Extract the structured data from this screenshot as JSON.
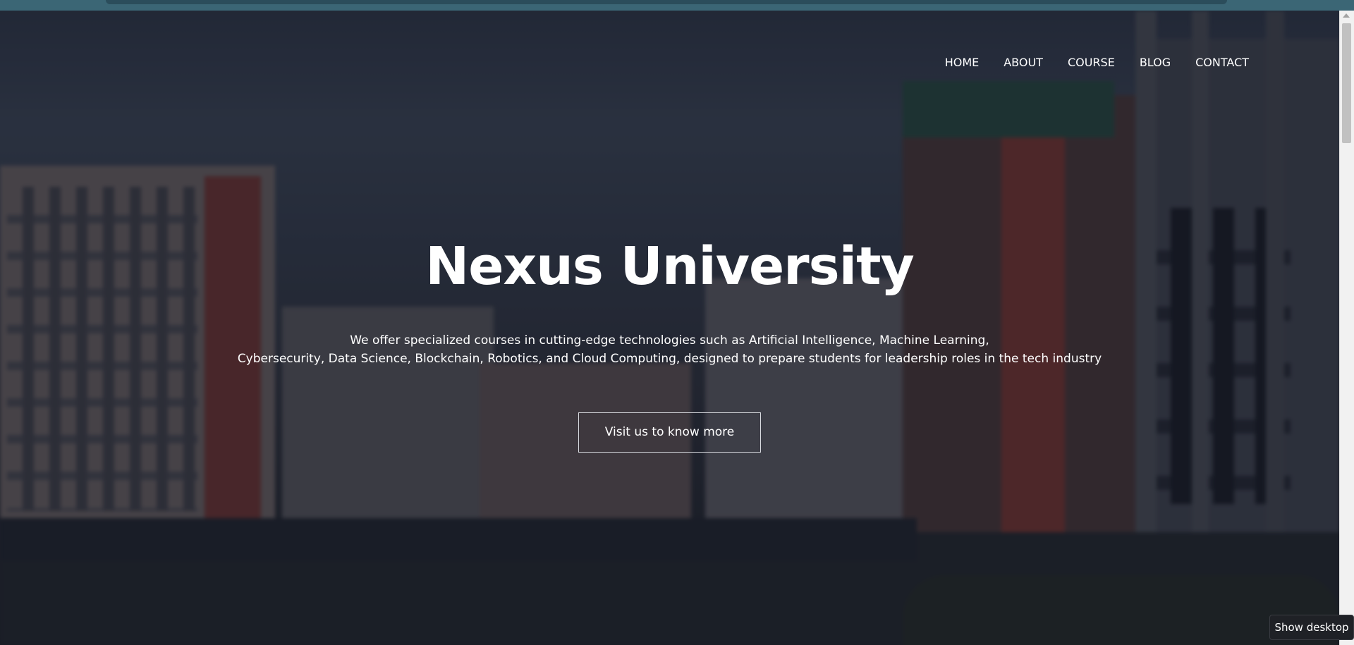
{
  "nav": {
    "items": [
      "HOME",
      "ABOUT",
      "COURSE",
      "BLOG",
      "CONTACT"
    ]
  },
  "hero": {
    "title": "Nexus University",
    "description_line1": "We offer specialized courses in cutting-edge technologies such as Artificial Intelligence, Machine Learning,",
    "description_line2": "Cybersecurity, Data Science, Blockchain, Robotics, and Cloud Computing, designed to prepare students for leadership roles in the tech industry",
    "cta_label": "Visit us to know more"
  },
  "taskbar_tooltip": "Show desktop",
  "colors": {
    "overlay": "#0f121e",
    "text": "#ffffff",
    "browser_strip": "#3b6675"
  }
}
